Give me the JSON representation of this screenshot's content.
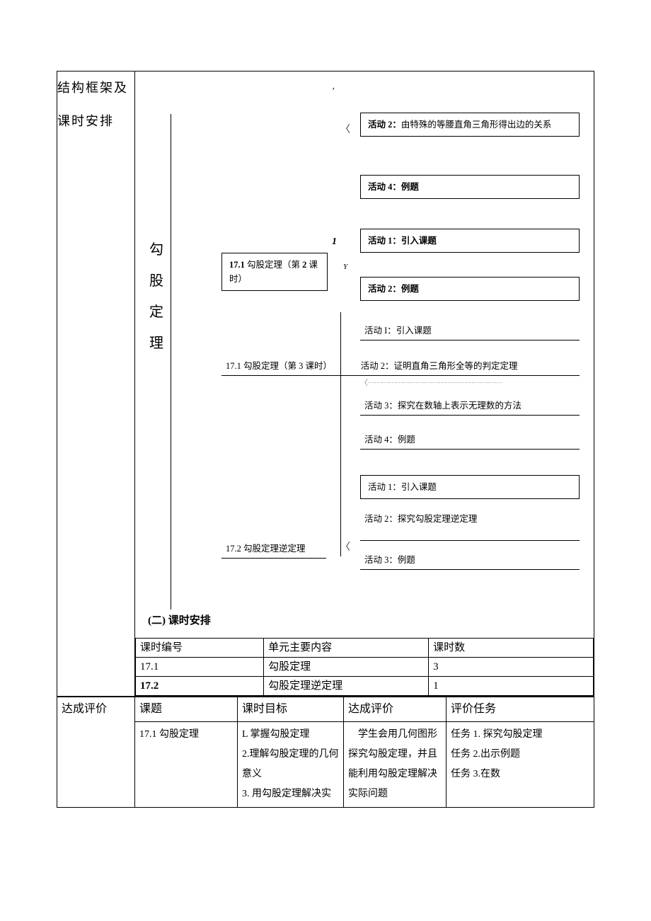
{
  "side_labels": {
    "structure": "结构框架及课时安排",
    "evaluation": "达成评价"
  },
  "diagram": {
    "root": "勾股定理",
    "section1": {
      "activity2": "活动 2：由特殊的等腰直角三角形得出边的关系",
      "activity4": "活动 4：例题"
    },
    "section2": {
      "title_prefix": "17.1",
      "title_body": "勾股定理（第",
      "title_num": "2",
      "title_suffix": "课时）",
      "activity1": "活动 1：引入课题",
      "activity2": "活动 2：例题"
    },
    "section3": {
      "title_prefix": "17.1",
      "title_body": "勾股定理（第",
      "title_num": "3",
      "title_suffix": "课时）",
      "activityI": "活动 I：引入课题",
      "activity2": "活动 2：证明直角三角形全等的判定定理",
      "activity3": "活动 3：探究在数轴上表示无理数的方法",
      "activity4": "活动 4：例题"
    },
    "section4": {
      "title_prefix": "17.2",
      "title_body": "勾股定理逆定理",
      "activity1": "活动 1：引入课题",
      "activity2": "活动 2：探究勾股定理逆定理",
      "activity3": "活动 3：例题"
    },
    "sub_header": "(二) 课时安排",
    "marks": {
      "tick": "′",
      "bracket_l": "〈",
      "one_italic": "1",
      "y_italic": "Y",
      "dash": "〈┄┄┄┄┄┄┄┄┄┄┄┄┄┄┄┄┄┄┄"
    }
  },
  "schedule": {
    "headers": {
      "id": "课时编号",
      "content": "单元主要内容",
      "hours": "课时数"
    },
    "rows": [
      {
        "id": "17.1",
        "content": "勾股定理",
        "hours": "3"
      },
      {
        "id": "17.2",
        "content": "勾股定理逆定理",
        "hours": "1"
      }
    ]
  },
  "evaluation": {
    "headers": {
      "topic": "课题",
      "goal": "课时目标",
      "achieve": "达成评价",
      "task": "评价任务"
    },
    "row": {
      "topic": "17.1 勾股定理",
      "goal": "L 掌握勾股定理\n2.理解勾股定理的几何意义\n3. 用勾股定理解决实",
      "achieve": "　学生会用几何图形探究勾股定理，并且能利用勾股定理解决实际问题",
      "task": "任务 1. 探究勾股定理\n任务 2.出示例题\n任务 3.在数"
    }
  }
}
